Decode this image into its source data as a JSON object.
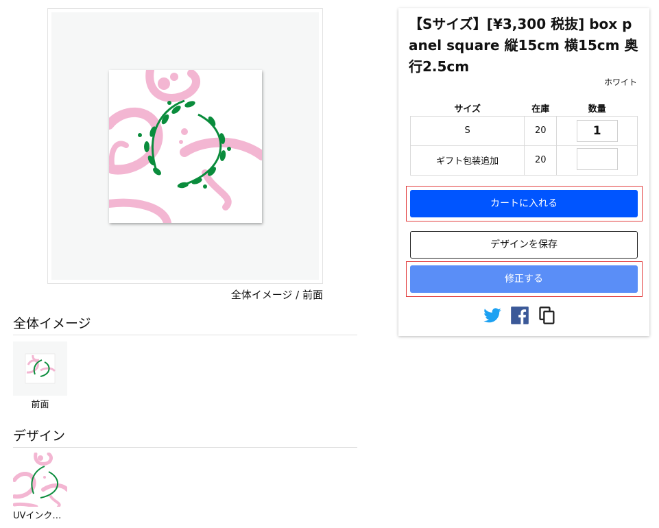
{
  "preview": {
    "caption": "全体イメージ / 前面"
  },
  "sections": {
    "overall_title": "全体イメージ",
    "overall_thumb_label": "前面",
    "design_title": "デザイン",
    "design_thumb_label": "UVインク…"
  },
  "product": {
    "title": "【Sサイズ】[¥3,300 税抜] box panel square 縦15cm 横15cm 奥行2.5cm",
    "color": "ホワイト",
    "table": {
      "headers": [
        "サイズ",
        "在庫",
        "数量"
      ],
      "rows": [
        {
          "name": "S",
          "stock": "20",
          "qty": "1"
        },
        {
          "name": "ギフト包装追加",
          "stock": "20",
          "qty": ""
        }
      ]
    },
    "buttons": {
      "add_to_cart": "カートに入れる",
      "save_design": "デザインを保存",
      "edit": "修正する"
    }
  },
  "share": {
    "icons": [
      "twitter-icon",
      "facebook-icon",
      "copy-icon"
    ]
  },
  "colors": {
    "cart_button": "#0055ff",
    "edit_button": "#5a8ef7",
    "highlight_border": "#e23a3a",
    "twitter": "#1da1f2",
    "facebook": "#3b5998",
    "motif_pink": "#f3b6d2",
    "motif_green": "#0a8c3c"
  }
}
